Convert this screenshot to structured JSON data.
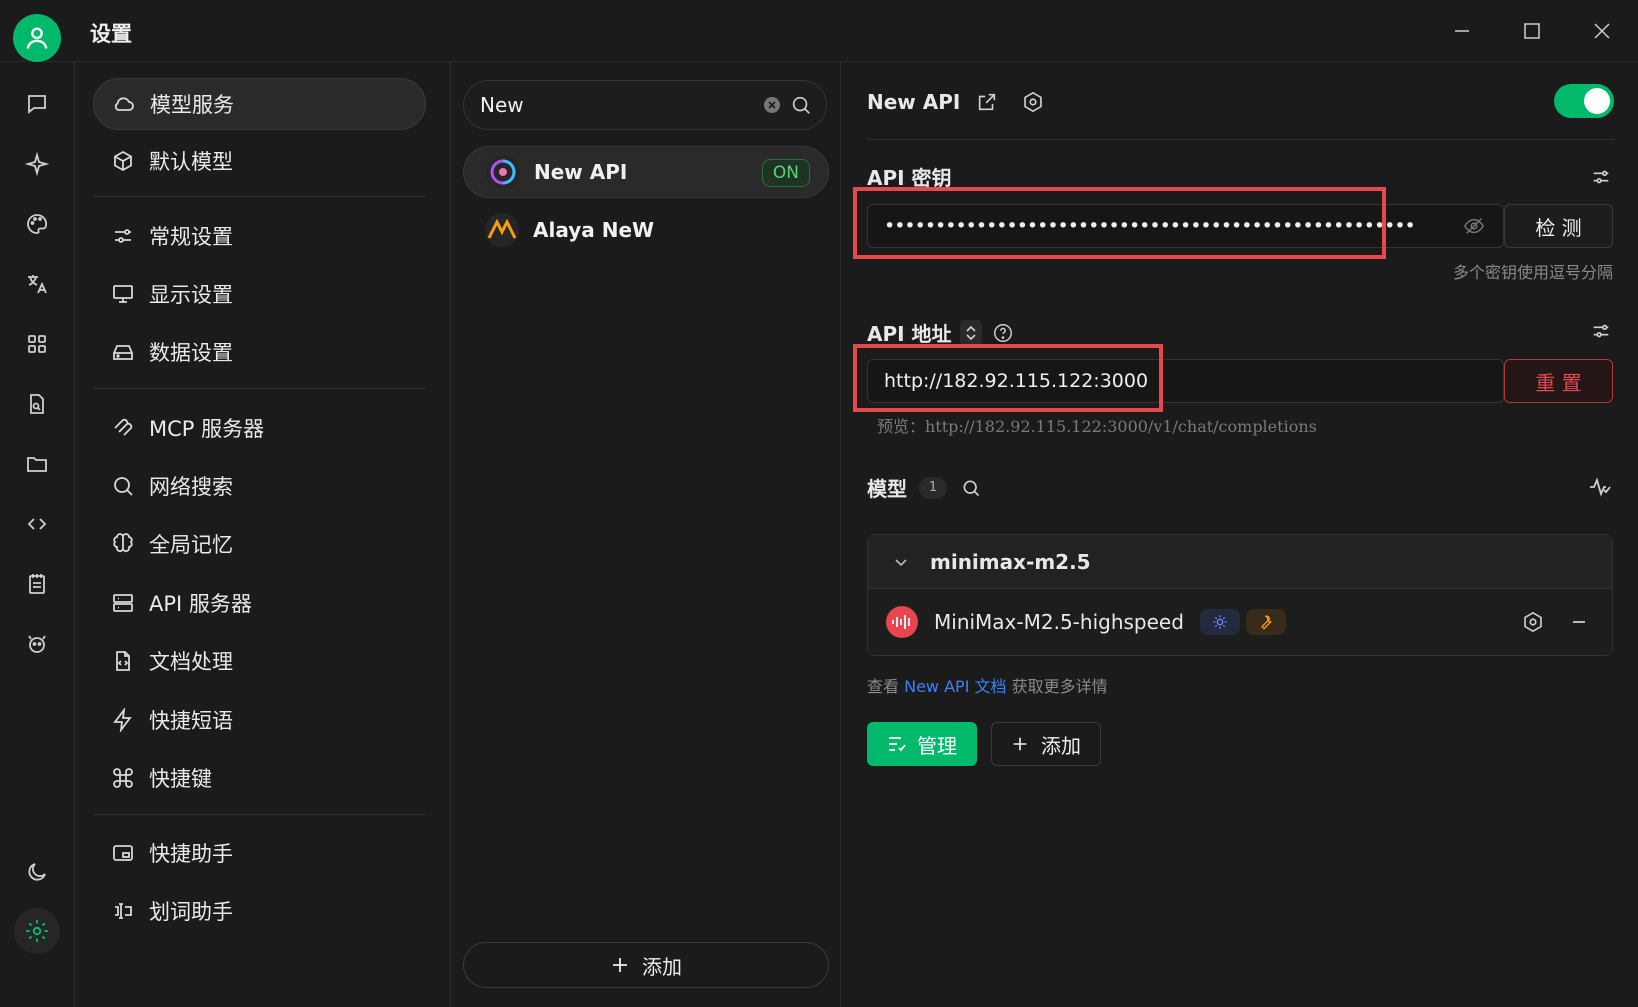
{
  "window": {
    "title": "设置"
  },
  "settings_nav": {
    "items": [
      {
        "label": "模型服务"
      },
      {
        "label": "默认模型"
      },
      {
        "label": "常规设置"
      },
      {
        "label": "显示设置"
      },
      {
        "label": "数据设置"
      },
      {
        "label": "MCP 服务器"
      },
      {
        "label": "网络搜索"
      },
      {
        "label": "全局记忆"
      },
      {
        "label": "API 服务器"
      },
      {
        "label": "文档处理"
      },
      {
        "label": "快捷短语"
      },
      {
        "label": "快捷键"
      },
      {
        "label": "快捷助手"
      },
      {
        "label": "划词助手"
      }
    ]
  },
  "providers": {
    "search_value": "New",
    "items": [
      {
        "name": "New API",
        "badge": "ON"
      },
      {
        "name": "Alaya NeW"
      }
    ],
    "add_label": "添加"
  },
  "detail": {
    "provider_name": "New API",
    "enabled": true,
    "api_key": {
      "label": "API 密钥",
      "value": "••••••••••••••••••••••••••••••••••••••••••••••••••••",
      "check_label": "检 测",
      "hint": "多个密钥使用逗号分隔"
    },
    "api_url": {
      "label": "API 地址",
      "value": "http://182.92.115.122:3000",
      "reset_label": "重 置",
      "preview": "预览：http://182.92.115.122:3000/v1/chat/completions"
    },
    "models": {
      "label": "模型",
      "count": "1",
      "group": "minimax-m2.5",
      "items": [
        {
          "name": "MiniMax-M2.5-highspeed"
        }
      ]
    },
    "docs": {
      "prefix": "查看",
      "link": "New API 文档",
      "suffix": "获取更多详情"
    },
    "manage_label": "管理",
    "add_label": "添加"
  },
  "colors": {
    "accent": "#00b96b",
    "danger": "#e5484d",
    "link": "#3b82f6"
  }
}
